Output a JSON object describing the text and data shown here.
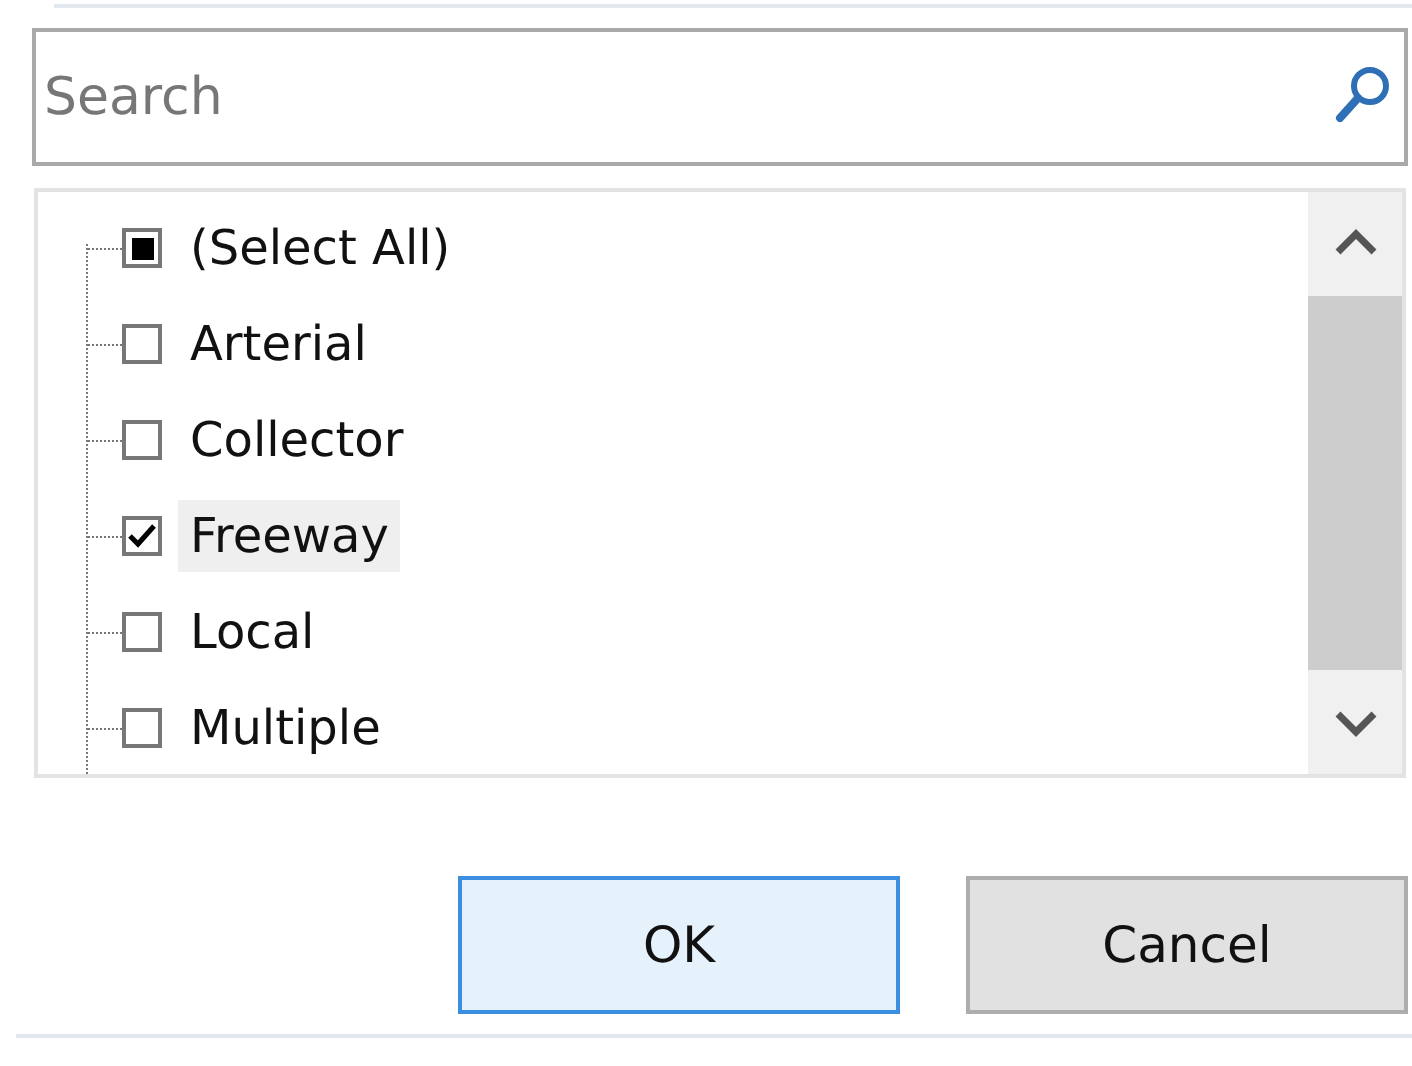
{
  "search": {
    "placeholder": "Search"
  },
  "items": [
    {
      "label": "(Select All)",
      "checked": false,
      "mixed": true,
      "selected": false
    },
    {
      "label": "Arterial",
      "checked": false,
      "mixed": false,
      "selected": false
    },
    {
      "label": "Collector",
      "checked": false,
      "mixed": false,
      "selected": false
    },
    {
      "label": "Freeway",
      "checked": true,
      "mixed": false,
      "selected": true
    },
    {
      "label": "Local",
      "checked": false,
      "mixed": false,
      "selected": false
    },
    {
      "label": "Multiple",
      "checked": false,
      "mixed": false,
      "selected": false
    }
  ],
  "buttons": [
    {
      "label": "OK",
      "default": true
    },
    {
      "label": "Cancel",
      "default": false
    }
  ]
}
